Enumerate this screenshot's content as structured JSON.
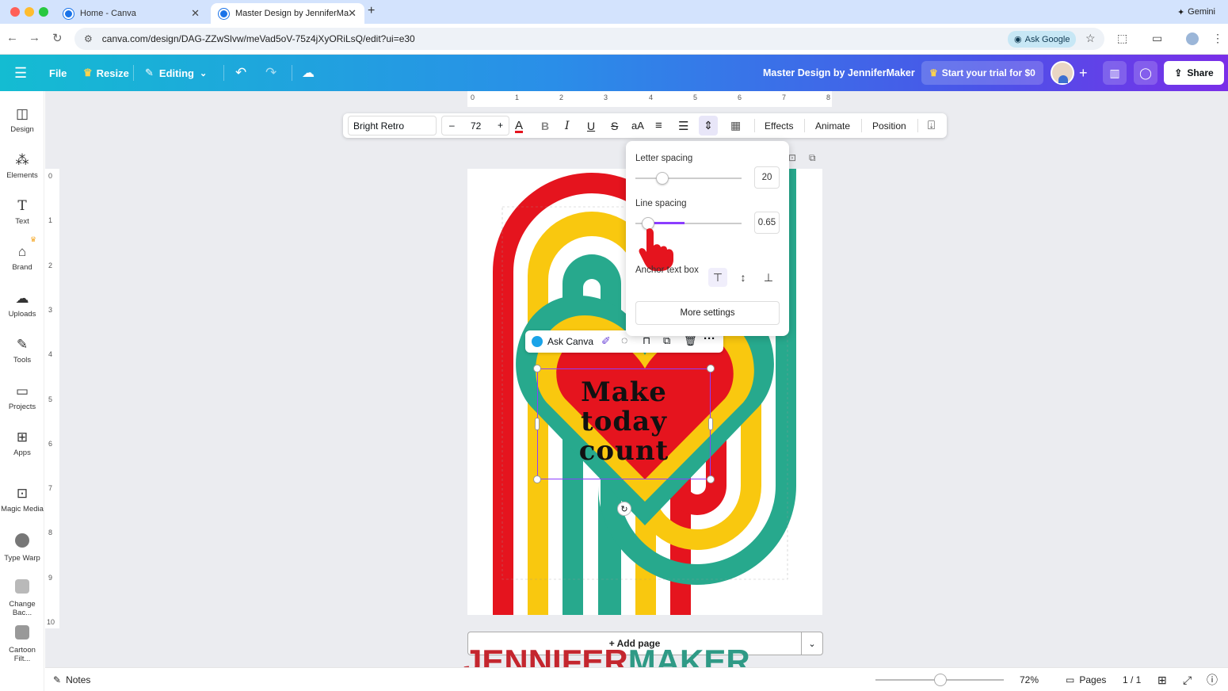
{
  "browser": {
    "tabs": [
      {
        "title": "Home - Canva",
        "active": false
      },
      {
        "title": "Master Design by JenniferMa",
        "active": true
      }
    ],
    "new_tab_icon": "plus-icon",
    "gemini_label": "Gemini",
    "url": "canva.com/design/DAG-ZZwSlvw/meVad5oV-75z4jXyORiLsQ/edit?ui=e30",
    "ask_google_label": "Ask Google"
  },
  "header": {
    "file_label": "File",
    "resize_label": "Resize",
    "editing_label": "Editing",
    "design_title": "Master Design by JenniferMaker",
    "trial_label": "Start your trial for $0",
    "share_label": "Share"
  },
  "sidebar": {
    "items": [
      {
        "label": "Design",
        "icon": "design-icon"
      },
      {
        "label": "Elements",
        "icon": "elements-icon"
      },
      {
        "label": "Text",
        "icon": "text-icon"
      },
      {
        "label": "Brand",
        "icon": "brand-icon"
      },
      {
        "label": "Uploads",
        "icon": "uploads-icon"
      },
      {
        "label": "Tools",
        "icon": "tools-icon"
      },
      {
        "label": "Projects",
        "icon": "projects-icon"
      },
      {
        "label": "Apps",
        "icon": "apps-icon"
      },
      {
        "label": "Magic Media",
        "icon": "magic-media-icon"
      },
      {
        "label": "Type Warp",
        "icon": "type-warp-icon"
      },
      {
        "label": "Change Bac...",
        "icon": "change-background-icon"
      },
      {
        "label": "Cartoon Filt...",
        "icon": "cartoon-filter-icon"
      }
    ]
  },
  "rulers": {
    "top": [
      "0",
      "1",
      "2",
      "3",
      "4",
      "5",
      "6",
      "7",
      "8"
    ],
    "left": [
      "0",
      "1",
      "2",
      "3",
      "4",
      "5",
      "6",
      "7",
      "8",
      "9",
      "10"
    ]
  },
  "text_toolbar": {
    "font_name": "Bright Retro",
    "font_size": "72",
    "minus": "–",
    "plus": "+",
    "case_label": "aA",
    "effects_label": "Effects",
    "animate_label": "Animate",
    "position_label": "Position"
  },
  "spacing_popup": {
    "letter_spacing_label": "Letter spacing",
    "letter_spacing_value": "20",
    "letter_spacing_fraction": 0.23,
    "line_spacing_label": "Line spacing",
    "line_spacing_value": "0.65",
    "line_spacing_fraction": 0.1,
    "anchor_label": "Anchor text box",
    "more_settings_label": "More settings"
  },
  "context_toolbar": {
    "ask_canva_label": "Ask Canva",
    "more_icon": "more-dots-icon"
  },
  "design": {
    "text_lines": [
      "Make",
      "today",
      "count"
    ],
    "colors": {
      "red": "#e5141e",
      "yellow": "#f9c80f",
      "teal": "#27a98d",
      "white": "#ffffff"
    }
  },
  "add_page_label": "+ Add page",
  "watermark": {
    "part1": "JENNIFER",
    "part2": "MAKER",
    "color1": "#c4262e",
    "color2": "#2f9a86"
  },
  "footer": {
    "notes_label": "Notes",
    "zoom_value": "72%",
    "zoom_fraction": 0.5,
    "pages_label": "Pages",
    "page_count": "1 / 1"
  },
  "colors": {
    "accent_purple": "#8b3dff",
    "header_start": "#14bcd2",
    "header_end": "#7a2ee8"
  }
}
